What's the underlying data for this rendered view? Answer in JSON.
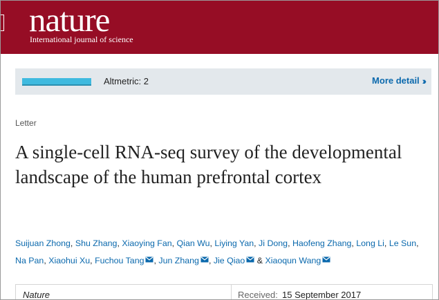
{
  "header": {
    "logo": "nature",
    "tagline": "International journal of science"
  },
  "metrics": {
    "altmetric_label": "Altmetric: 2",
    "more_detail": "More detail"
  },
  "article": {
    "type": "Letter",
    "title": "A single-cell RNA-seq survey of the developmental landscape of the human prefrontal cortex",
    "authors": [
      {
        "name": "Suijuan Zhong",
        "mail": false
      },
      {
        "name": "Shu Zhang",
        "mail": false
      },
      {
        "name": "Xiaoying Fan",
        "mail": false
      },
      {
        "name": "Qian Wu",
        "mail": false
      },
      {
        "name": "Liying Yan",
        "mail": false
      },
      {
        "name": "Ji Dong",
        "mail": false
      },
      {
        "name": "Haofeng Zhang",
        "mail": false
      },
      {
        "name": "Long Li",
        "mail": false
      },
      {
        "name": "Le Sun",
        "mail": false
      },
      {
        "name": "Na Pan",
        "mail": false
      },
      {
        "name": "Xiaohui Xu",
        "mail": false
      },
      {
        "name": "Fuchou Tang",
        "mail": true
      },
      {
        "name": "Jun Zhang",
        "mail": true
      },
      {
        "name": "Jie Qiao",
        "mail": true
      },
      {
        "name": "Xiaoqun Wang",
        "mail": true
      }
    ],
    "separator": ", ",
    "final_separator": " & ",
    "journal": "Nature",
    "received_label": "Received:",
    "received_date": "15 September 2017"
  },
  "colors": {
    "header_bg": "#960d25",
    "link": "#0b69ad",
    "altmetric_bar": "#3fbadf",
    "metrics_bg": "#e3e8ec"
  }
}
